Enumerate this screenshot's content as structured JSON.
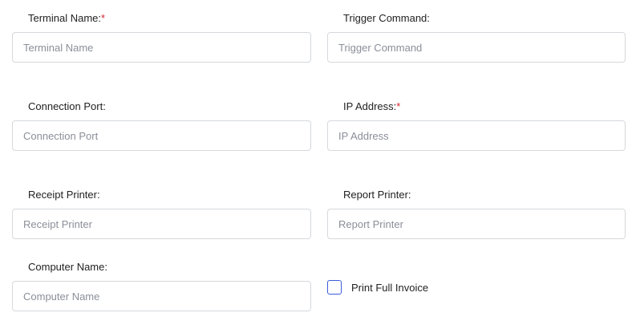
{
  "form": {
    "terminal_name": {
      "label": "Terminal Name:",
      "required_mark": "*",
      "placeholder": "Terminal Name",
      "value": ""
    },
    "trigger_command": {
      "label": "Trigger Command:",
      "placeholder": "Trigger Command",
      "value": ""
    },
    "connection_port": {
      "label": "Connection Port:",
      "placeholder": "Connection Port",
      "value": ""
    },
    "ip_address": {
      "label": "IP Address:",
      "required_mark": "*",
      "placeholder": "IP Address",
      "value": ""
    },
    "receipt_printer": {
      "label": "Receipt Printer:",
      "placeholder": "Receipt Printer",
      "value": ""
    },
    "report_printer": {
      "label": "Report Printer:",
      "placeholder": "Report Printer",
      "value": ""
    },
    "computer_name": {
      "label": "Computer Name:",
      "placeholder": "Computer Name",
      "value": ""
    },
    "print_full_invoice": {
      "label": "Print Full Invoice",
      "checked": false
    }
  },
  "colors": {
    "required": "#d9232e",
    "checkbox_border": "#3b5bdb",
    "input_border": "#d6d8dc",
    "placeholder": "#8a8f98"
  }
}
